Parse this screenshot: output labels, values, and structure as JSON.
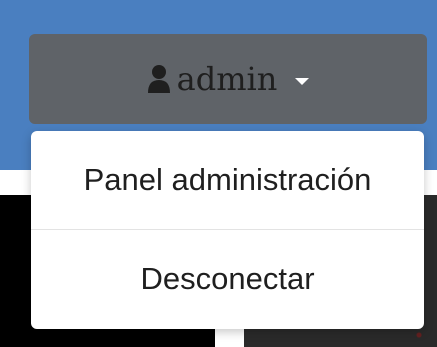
{
  "navbar": {
    "color": "#4a7fc0"
  },
  "user_menu": {
    "icon": "user-icon",
    "label": "admin",
    "caret_icon": "caret-down-icon",
    "button_color": "#5f6368"
  },
  "dropdown": {
    "items": [
      {
        "label": "Panel administración"
      },
      {
        "label": "Desconectar"
      }
    ]
  }
}
